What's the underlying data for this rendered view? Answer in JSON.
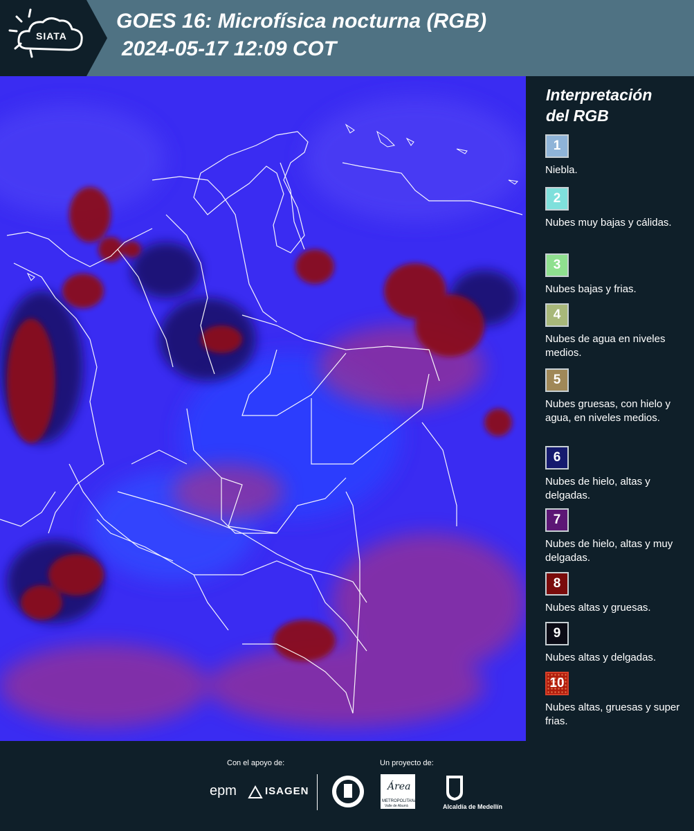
{
  "header": {
    "logo_text": "SIATA",
    "title_line1": "GOES 16: Microfísica nocturna (RGB)",
    "title_line2": "2024-05-17 12:09 COT"
  },
  "colors": {
    "header_bg": "#4f7283",
    "panel_bg": "#0f1f29",
    "map_base": "#3a2cf2",
    "cloud_thick_high": "#8b0f1e"
  },
  "legend": {
    "title_line1": "Interpretación",
    "title_line2": "del RGB",
    "items": [
      {
        "number": "1",
        "color": "#8fb4d8",
        "label": "Niebla."
      },
      {
        "number": "2",
        "color": "#7fe0dc",
        "label": "Nubes muy bajas y cálidas."
      },
      {
        "number": "3",
        "color": "#8fe08f",
        "label": "Nubes bajas y frias."
      },
      {
        "number": "4",
        "color": "#a8b87a",
        "label": "Nubes de agua en niveles medios."
      },
      {
        "number": "5",
        "color": "#a08858",
        "label": "Nubes gruesas, con hielo y agua, en niveles medios."
      },
      {
        "number": "6",
        "color": "#151a6e",
        "label": "Nubes de hielo, altas y delgadas."
      },
      {
        "number": "7",
        "color": "#5c1675",
        "label": "Nubes de hielo, altas y muy delgadas."
      },
      {
        "number": "8",
        "color": "#7a0b0b",
        "label": "Nubes altas y gruesas."
      },
      {
        "number": "9",
        "color": "#0b0b15",
        "label": "Nubes altas y delgadas."
      },
      {
        "number": "10",
        "color": "#b01c0c",
        "label": "Nubes altas, gruesas y super frias."
      }
    ]
  },
  "footer": {
    "support_caption": "Con el apoyo de:",
    "project_caption": "Un proyecto de:",
    "sponsor_epm": "epm",
    "sponsor_isagen": "ISAGEN",
    "metro_line1": "METROPOLITANA",
    "metro_line2": "Valle de Aburrá",
    "metro_script": "Área",
    "medellin": "Alcaldía de Medellín"
  }
}
